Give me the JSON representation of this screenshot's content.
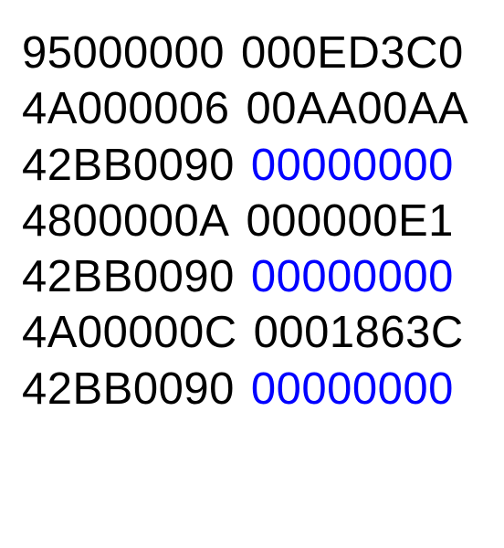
{
  "colors": {
    "black": "#000000",
    "blue": "#0000ff"
  },
  "rows": [
    {
      "col1": {
        "text": "95000000",
        "color": "black"
      },
      "col2": {
        "text": "000ED3C0",
        "color": "black"
      }
    },
    {
      "col1": {
        "text": "4A000006",
        "color": "black"
      },
      "col2": {
        "text": "00AA00AA",
        "color": "black"
      }
    },
    {
      "col1": {
        "text": "42BB0090",
        "color": "black"
      },
      "col2": {
        "text": "00000000",
        "color": "blue"
      }
    },
    {
      "col1": {
        "text": "4800000A",
        "color": "black"
      },
      "col2": {
        "text": "000000E1",
        "color": "black"
      }
    },
    {
      "col1": {
        "text": "42BB0090",
        "color": "black"
      },
      "col2": {
        "text": "00000000",
        "color": "blue"
      }
    },
    {
      "col1": {
        "text": "4A00000C",
        "color": "black"
      },
      "col2": {
        "text": "0001863C",
        "color": "black"
      }
    },
    {
      "col1": {
        "text": "42BB0090",
        "color": "black"
      },
      "col2": {
        "text": "00000000",
        "color": "blue"
      }
    }
  ]
}
